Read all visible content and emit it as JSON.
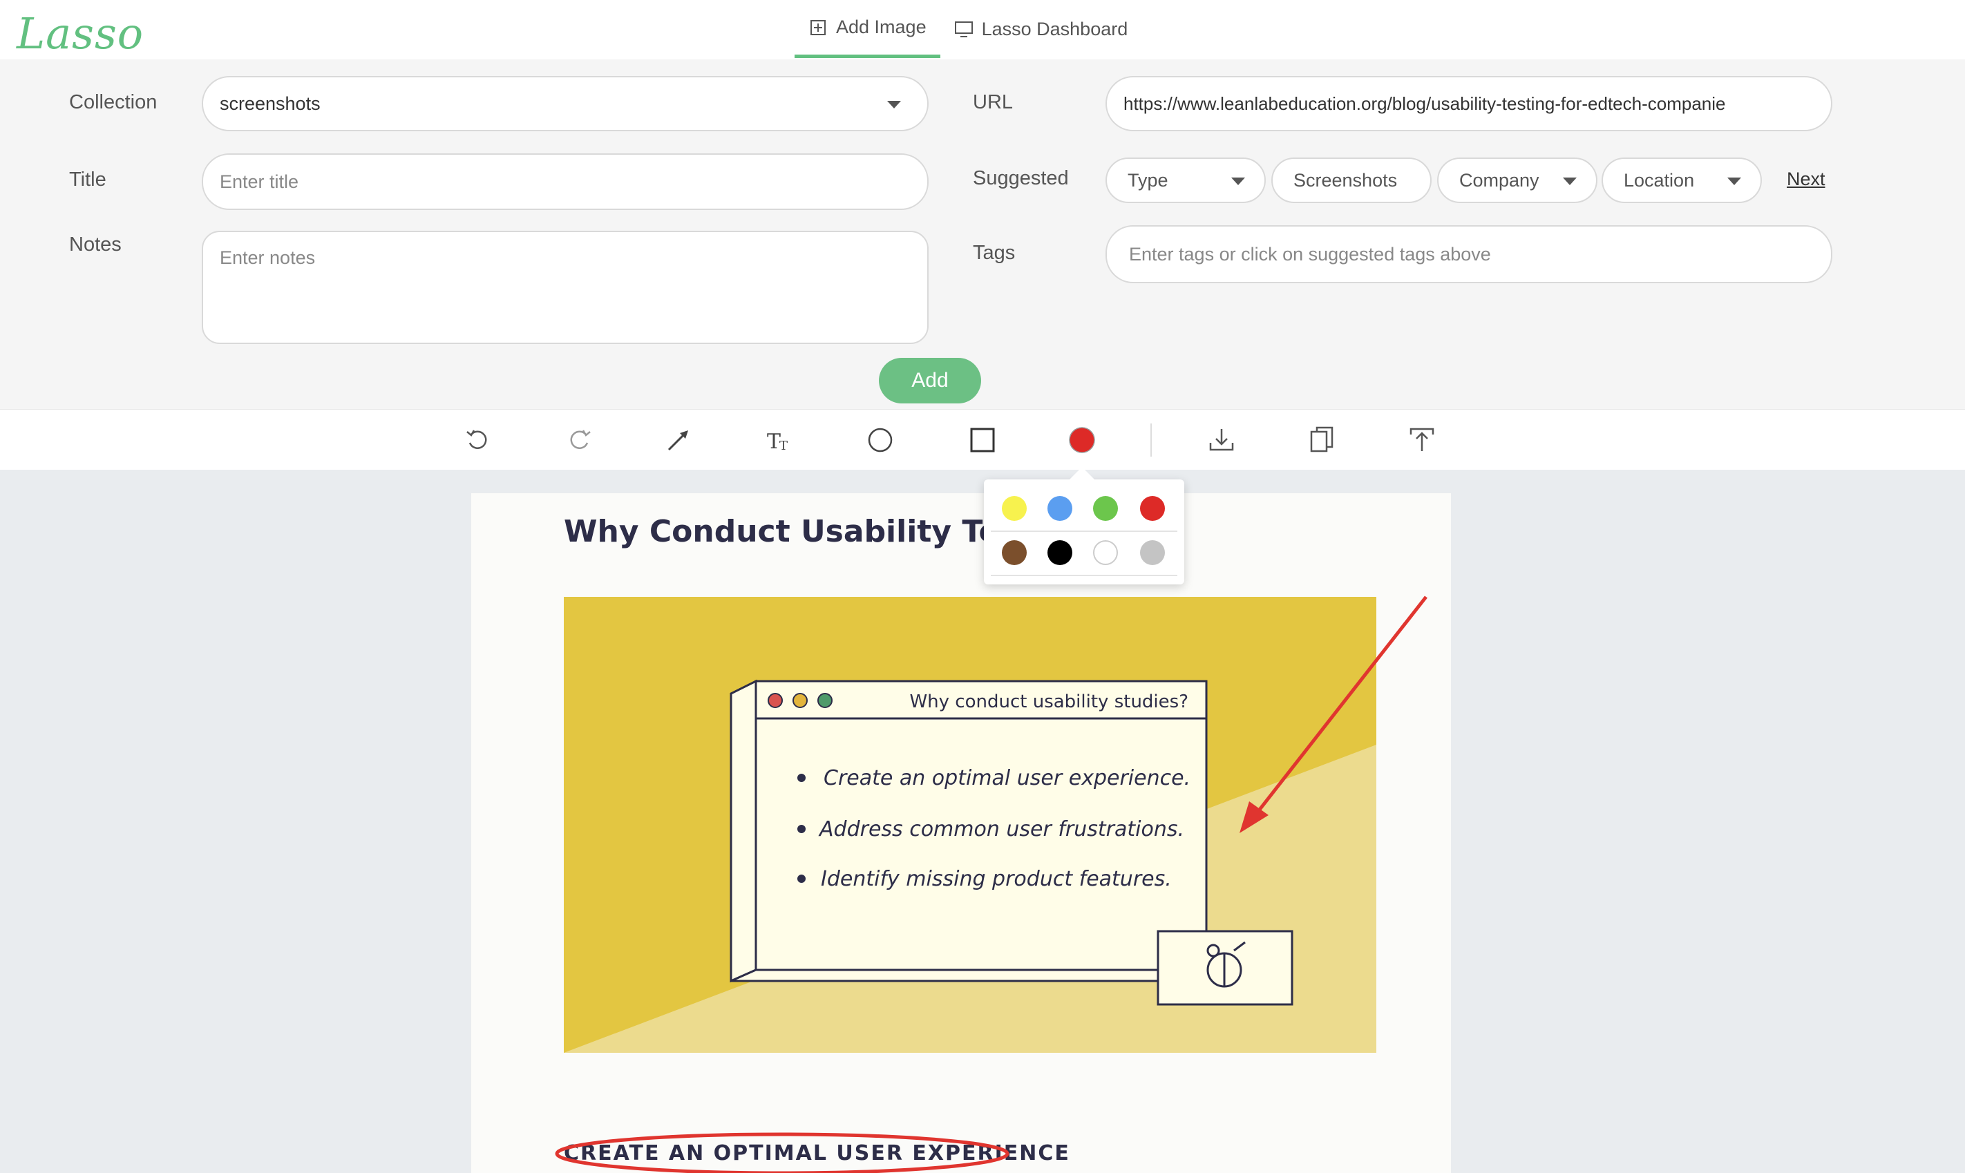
{
  "app": {
    "logo": "Lasso"
  },
  "tabs": [
    {
      "label": "Add Image",
      "icon": "plus-square-icon",
      "active": true
    },
    {
      "label": "Lasso Dashboard",
      "icon": "monitor-icon",
      "active": false
    }
  ],
  "form": {
    "collection": {
      "label": "Collection",
      "value": "screenshots"
    },
    "title": {
      "label": "Title",
      "placeholder": "Enter title"
    },
    "notes": {
      "label": "Notes",
      "placeholder": "Enter notes"
    },
    "url": {
      "label": "URL",
      "value": "https://www.leanlabeducation.org/blog/usability-testing-for-edtech-companie"
    },
    "suggested": {
      "label": "Suggested",
      "pills": [
        "Type",
        "Screenshots",
        "Company",
        "Location"
      ],
      "next": "Next"
    },
    "tags": {
      "label": "Tags",
      "placeholder": "Enter tags or click on suggested tags above"
    },
    "add_button": "Add"
  },
  "toolbar": {
    "tools": [
      "undo-icon",
      "redo-icon",
      "arrow-tool-icon",
      "text-tool-icon",
      "circle-tool-icon",
      "rectangle-tool-icon",
      "color-picker-icon",
      "download-icon",
      "copy-icon",
      "upload-icon"
    ],
    "selected_color": "#dd2a27"
  },
  "color_palette": {
    "row1": [
      "#f7f24e",
      "#5b9ef0",
      "#6cc64c",
      "#dd2a27"
    ],
    "row2": [
      "#7b4f2c",
      "#000000",
      "#ffffff",
      "#c4c4c4"
    ]
  },
  "article": {
    "title": "Why Conduct Usability Testin",
    "window_title": "Why conduct usability studies?",
    "bullets": [
      "Create an optimal user experience.",
      "Address common user frustrations.",
      "Identify missing product features."
    ],
    "subheading": "CREATE AN OPTIMAL USER EXPERIENCE"
  }
}
